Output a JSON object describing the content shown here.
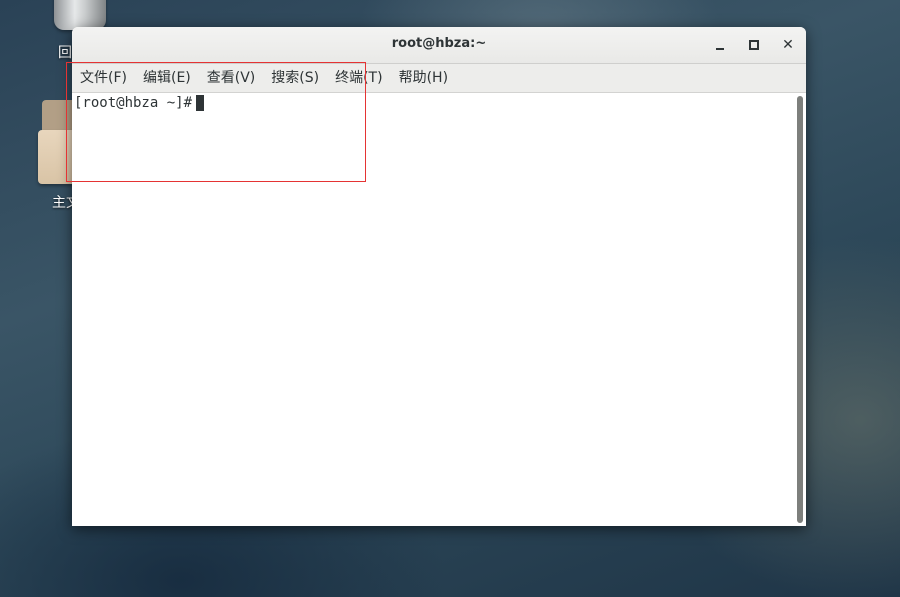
{
  "desktop": {
    "icons": [
      {
        "label": "回",
        "icon": "trash-icon"
      },
      {
        "label": "主文",
        "icon": "folder-icon"
      }
    ]
  },
  "window": {
    "title": "root@hbza:~",
    "controls": {
      "minimize": "minimize-icon",
      "maximize": "maximize-icon",
      "close": "✕"
    }
  },
  "menu": {
    "items": [
      {
        "label": "文件(F)"
      },
      {
        "label": "编辑(E)"
      },
      {
        "label": "查看(V)"
      },
      {
        "label": "搜索(S)"
      },
      {
        "label": "终端(T)"
      },
      {
        "label": "帮助(H)"
      }
    ]
  },
  "terminal": {
    "prompt": "[root@hbza ~]#"
  },
  "colors": {
    "highlight": "#e53333"
  }
}
